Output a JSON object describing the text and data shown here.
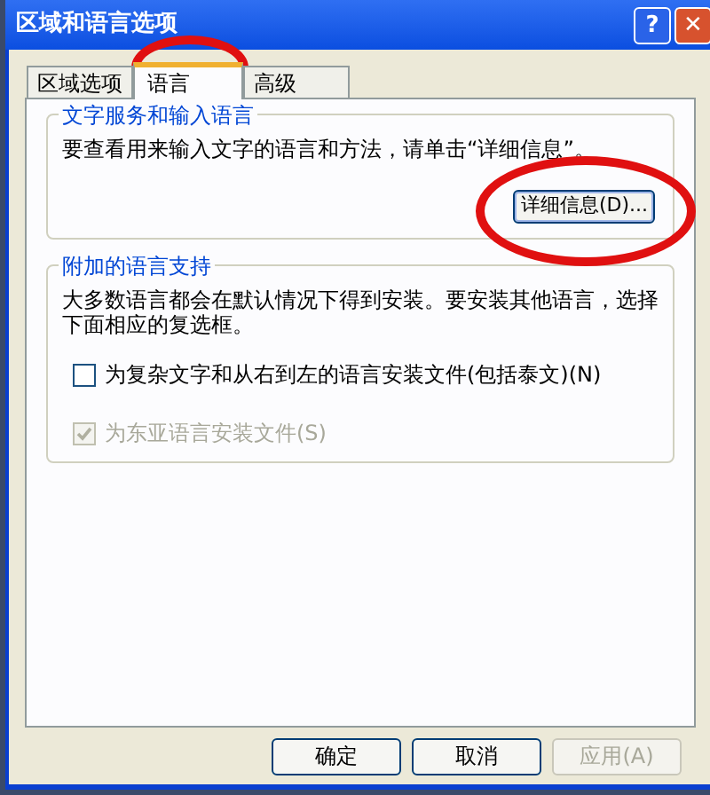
{
  "window": {
    "title": "区域和语言选项"
  },
  "title_buttons": [
    "?",
    "✕"
  ],
  "tabs": [
    {
      "label": "区域选项",
      "selected": false
    },
    {
      "label": "语言",
      "selected": true
    },
    {
      "label": "高级",
      "selected": false
    }
  ],
  "text_services": {
    "title": "文字服务和输入语言",
    "description": "要查看用来输入文字的语言和方法，请单击“详细信息”。",
    "button": "详细信息(D)..."
  },
  "supplemental": {
    "title": "附加的语言支持",
    "description": "大多数语言都会在默认情况下得到安装。要安装其他语言，选择下面相应的复选框。",
    "options": [
      {
        "label": "为复杂文字和从右到左的语言安装文件(包括泰文)(N)",
        "checked": false,
        "disabled": false
      },
      {
        "label": "为东亚语言安装文件(S)",
        "checked": true,
        "disabled": true
      }
    ]
  },
  "buttons": [
    {
      "label": "确定",
      "disabled": false
    },
    {
      "label": "取消",
      "disabled": false
    },
    {
      "label": "应用(A)",
      "disabled": true
    }
  ],
  "annotations": [
    {
      "kind": "ellipse"
    },
    {
      "kind": "ellipse"
    }
  ]
}
